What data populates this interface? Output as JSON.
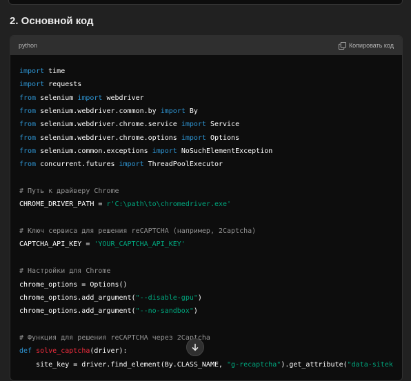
{
  "section": {
    "heading": "2. Основной код"
  },
  "code_block": {
    "language": "python",
    "copy_label": "Копировать код",
    "lines": [
      [
        {
          "t": "import",
          "c": "kw"
        },
        {
          "t": " time",
          "c": ""
        }
      ],
      [
        {
          "t": "import",
          "c": "kw"
        },
        {
          "t": " requests",
          "c": ""
        }
      ],
      [
        {
          "t": "from",
          "c": "kw"
        },
        {
          "t": " selenium ",
          "c": ""
        },
        {
          "t": "import",
          "c": "kw"
        },
        {
          "t": " webdriver",
          "c": ""
        }
      ],
      [
        {
          "t": "from",
          "c": "kw"
        },
        {
          "t": " selenium.webdriver.common.by ",
          "c": ""
        },
        {
          "t": "import",
          "c": "kw"
        },
        {
          "t": " By",
          "c": ""
        }
      ],
      [
        {
          "t": "from",
          "c": "kw"
        },
        {
          "t": " selenium.webdriver.chrome.service ",
          "c": ""
        },
        {
          "t": "import",
          "c": "kw"
        },
        {
          "t": " Service",
          "c": ""
        }
      ],
      [
        {
          "t": "from",
          "c": "kw"
        },
        {
          "t": " selenium.webdriver.chrome.options ",
          "c": ""
        },
        {
          "t": "import",
          "c": "kw"
        },
        {
          "t": " Options",
          "c": ""
        }
      ],
      [
        {
          "t": "from",
          "c": "kw"
        },
        {
          "t": " selenium.common.exceptions ",
          "c": ""
        },
        {
          "t": "import",
          "c": "kw"
        },
        {
          "t": " NoSuchElementException",
          "c": ""
        }
      ],
      [
        {
          "t": "from",
          "c": "kw"
        },
        {
          "t": " concurrent.futures ",
          "c": ""
        },
        {
          "t": "import",
          "c": "kw"
        },
        {
          "t": " ThreadPoolExecutor",
          "c": ""
        }
      ],
      [],
      [
        {
          "t": "# Путь к драйверу Chrome",
          "c": "cm"
        }
      ],
      [
        {
          "t": "CHROME_DRIVER_PATH = ",
          "c": ""
        },
        {
          "t": "r'C:\\path\\to\\chromedriver.exe'",
          "c": "str"
        }
      ],
      [],
      [
        {
          "t": "# Ключ сервиса для решения reCAPTCHA (например, 2Captcha)",
          "c": "cm"
        }
      ],
      [
        {
          "t": "CAPTCHA_API_KEY = ",
          "c": ""
        },
        {
          "t": "'YOUR_CAPTCHA_API_KEY'",
          "c": "str"
        }
      ],
      [],
      [
        {
          "t": "# Настройки для Chrome",
          "c": "cm"
        }
      ],
      [
        {
          "t": "chrome_options = Options()",
          "c": ""
        }
      ],
      [
        {
          "t": "chrome_options.add_argument(",
          "c": ""
        },
        {
          "t": "\"--disable-gpu\"",
          "c": "str"
        },
        {
          "t": ")",
          "c": ""
        }
      ],
      [
        {
          "t": "chrome_options.add_argument(",
          "c": ""
        },
        {
          "t": "\"--no-sandbox\"",
          "c": "str"
        },
        {
          "t": ")",
          "c": ""
        }
      ],
      [],
      [
        {
          "t": "# Функция для решения reCAPTCHA через 2Captcha",
          "c": "cm"
        }
      ],
      [
        {
          "t": "def",
          "c": "kw"
        },
        {
          "t": " ",
          "c": ""
        },
        {
          "t": "solve_captcha",
          "c": "fn"
        },
        {
          "t": "(driver):",
          "c": ""
        }
      ],
      [
        {
          "t": "    site_key = driver.find_element(By.CLASS_NAME, ",
          "c": ""
        },
        {
          "t": "\"g-recaptcha\"",
          "c": "str"
        },
        {
          "t": ").get_attribute(",
          "c": ""
        },
        {
          "t": "\"data-sitek",
          "c": "str"
        }
      ]
    ]
  },
  "icons": {
    "copy": "copy-icon",
    "scroll_down": "arrow-down-icon"
  },
  "colors": {
    "keyword": "#2e95d3",
    "function": "#f22c3d",
    "string": "#00a67d",
    "background": "#212121",
    "code_background": "#0d0d0d"
  }
}
